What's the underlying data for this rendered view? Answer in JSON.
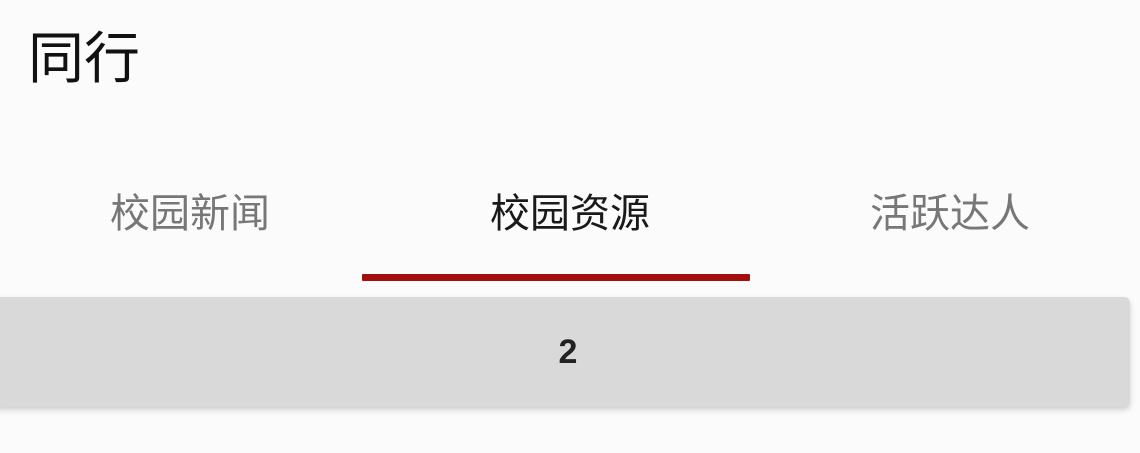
{
  "header": {
    "title": "同行"
  },
  "tabs": [
    {
      "label": "校园新闻",
      "active": false
    },
    {
      "label": "校园资源",
      "active": true
    },
    {
      "label": "活跃达人",
      "active": false
    }
  ],
  "indicator": {
    "color": "#a30f0f"
  },
  "content": {
    "card_value": "2"
  }
}
